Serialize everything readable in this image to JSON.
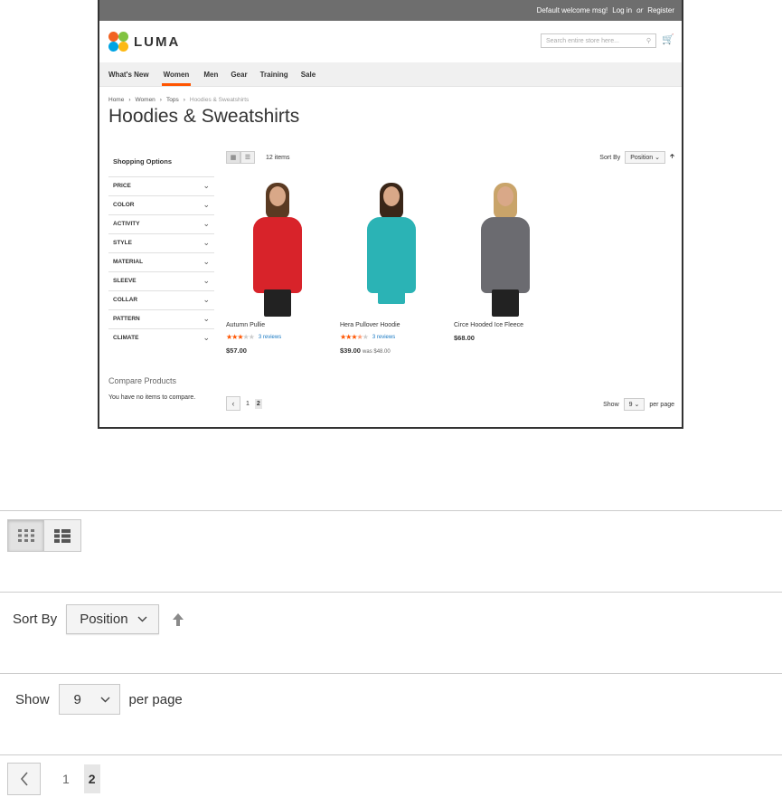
{
  "topbar": {
    "welcome": "Default welcome msg!",
    "login": "Log in",
    "or": "or",
    "register": "Register"
  },
  "logo": {
    "word": "LUMA"
  },
  "search": {
    "placeholder": "Search entire store here..."
  },
  "nav": [
    "What's New",
    "Women",
    "Men",
    "Gear",
    "Training",
    "Sale"
  ],
  "breadcrumbs": [
    "Home",
    "Women",
    "Tops",
    "Hoodies & Sweatshirts"
  ],
  "page_title": "Hoodies & Sweatshirts",
  "sidebar": {
    "title": "Shopping Options",
    "filters": [
      "PRICE",
      "COLOR",
      "ACTIVITY",
      "STYLE",
      "MATERIAL",
      "SLEEVE",
      "COLLAR",
      "PATTERN",
      "CLIMATE"
    ],
    "compare_title": "Compare Products",
    "compare_text": "You have no items to compare."
  },
  "toolbar": {
    "items_count": "12 items",
    "sort_label": "Sort By",
    "sort_value": "Position",
    "show_label": "Show",
    "show_value": "9",
    "per_page": "per page"
  },
  "products": [
    {
      "name": "Autumn Pullie",
      "reviews": "3 reviews",
      "price": "$57.00",
      "was": "",
      "rating": 3,
      "colors": {
        "top": "#d8232a",
        "hair": "#5a3a22"
      }
    },
    {
      "name": "Hera Pullover Hoodie",
      "reviews": "3 reviews",
      "price": "$39.00",
      "was": "was $48.00",
      "rating": 3.5,
      "colors": {
        "top": "#2bb3b5",
        "hair": "#3a2618"
      }
    },
    {
      "name": "Circe Hooded Ice Fleece",
      "reviews": "",
      "price": "$68.00",
      "was": "",
      "rating": 0,
      "colors": {
        "top": "#6b6b70",
        "hair": "#c9a46a"
      }
    }
  ],
  "pager": {
    "pages": [
      "1",
      "2"
    ],
    "current": "2"
  },
  "detail": {
    "sort_label": "Sort By",
    "sort_value": "Position",
    "show_label": "Show",
    "show_value": "9",
    "per_page": "per page",
    "pages": [
      "1",
      "2"
    ]
  },
  "colors": {
    "accent": "#ff5501",
    "link": "#1979c3"
  }
}
